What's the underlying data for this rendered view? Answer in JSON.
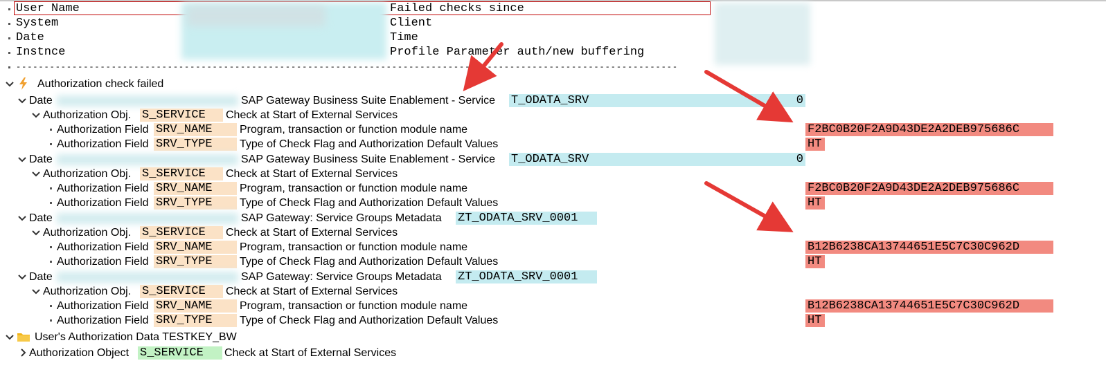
{
  "header": {
    "user_name_label": "User Name",
    "failed_checks_label": "Failed checks since",
    "system_label": "System",
    "client_label": "Client",
    "date_label": "Date",
    "time_label": "Time",
    "instance_label": "Instnce",
    "profile_param_label": "Profile Parameter auth/new buffering",
    "separator": "----------------------------------------------------------------------------------------------------------------------"
  },
  "tree": {
    "auth_check_failed_label": "Authorization check failed",
    "date_label": "Date",
    "auth_obj_label": "Authorization Obj.",
    "auth_field_label": "Authorization Field",
    "entries": [
      {
        "description": "SAP Gateway Business Suite Enablement - Service",
        "service": "T_ODATA_SRV",
        "count": "0",
        "object": "S_SERVICE",
        "object_text": "Check at Start of External Services",
        "field1": "SRV_NAME",
        "field1_text": "Program, transaction or function module name",
        "field1_value": "F2BC0B20F2A9D43DE2A2DEB975686C",
        "field2": "SRV_TYPE",
        "field2_text": "Type of Check Flag and Authorization Default Values",
        "field2_value": "HT"
      },
      {
        "description": "SAP Gateway Business Suite Enablement - Service",
        "service": "T_ODATA_SRV",
        "count": "0",
        "object": "S_SERVICE",
        "object_text": "Check at Start of External Services",
        "field1": "SRV_NAME",
        "field1_text": "Program, transaction or function module name",
        "field1_value": "F2BC0B20F2A9D43DE2A2DEB975686C",
        "field2": "SRV_TYPE",
        "field2_text": "Type of Check Flag and Authorization Default Values",
        "field2_value": "HT"
      },
      {
        "description": "SAP Gateway: Service Groups Metadata",
        "service": "ZT_ODATA_SRV_0001",
        "count": "",
        "object": "S_SERVICE",
        "object_text": "Check at Start of External Services",
        "field1": "SRV_NAME",
        "field1_text": "Program, transaction or function module name",
        "field1_value": "B12B6238CA13744651E5C7C30C962D",
        "field2": "SRV_TYPE",
        "field2_text": "Type of Check Flag and Authorization Default Values",
        "field2_value": "HT"
      },
      {
        "description": "SAP Gateway: Service Groups Metadata",
        "service": "ZT_ODATA_SRV_0001",
        "count": "",
        "object": "S_SERVICE",
        "object_text": "Check at Start of External Services",
        "field1": "SRV_NAME",
        "field1_text": "Program, transaction or function module name",
        "field1_value": "B12B6238CA13744651E5C7C30C962D",
        "field2": "SRV_TYPE",
        "field2_text": "Type of Check Flag and Authorization Default Values",
        "field2_value": "HT"
      }
    ],
    "users_auth_data_label": "User's Authorization Data TESTKEY_BW",
    "auth_object_label": "Authorization Object",
    "auth_object_value": "S_SERVICE",
    "auth_object_text": "Check at Start of External Services"
  },
  "colors": {
    "highlight_teal": "#c4ebf0",
    "highlight_tan": "#fbe2c6",
    "highlight_green": "#c2f2c4",
    "highlight_red": "#f28a80",
    "arrow_red": "#e53935",
    "lightning": "#f0a030",
    "folder": "#f2b418"
  },
  "icons": [
    "chevron-down-icon",
    "chevron-right-icon",
    "lightning-icon",
    "folder-icon",
    "arrow-annotation"
  ]
}
